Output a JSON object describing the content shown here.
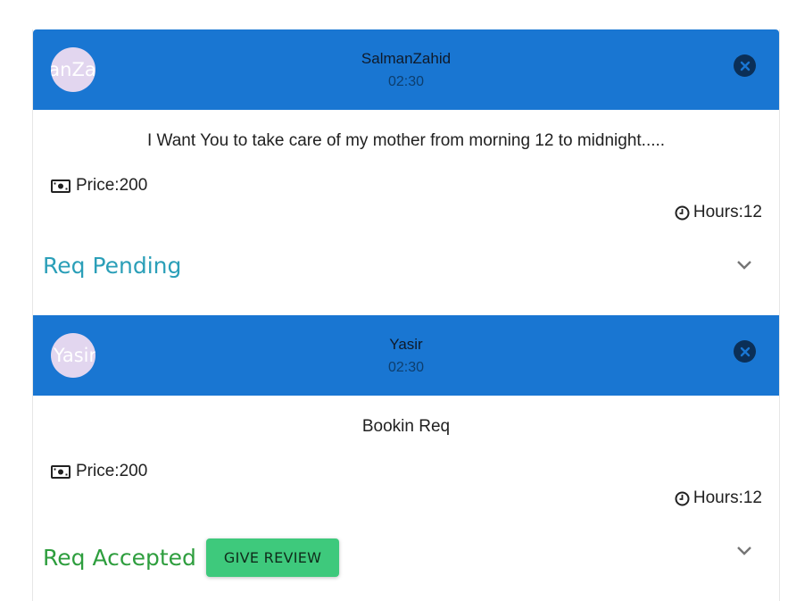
{
  "requests": [
    {
      "avatar_text": "SalmanZahid",
      "name": "SalmanZahid",
      "time": "02:30",
      "message": "I Want You to take care of my mother from morning 12 to midnight.....",
      "price": "Price:200",
      "hours": "Hours:12",
      "status": "Req Pending",
      "review_label": ""
    },
    {
      "avatar_text": "Yasir",
      "name": "Yasir",
      "time": "02:30",
      "message": "Bookin Req",
      "price": "Price:200",
      "hours": "Hours:12",
      "status": "Req Accepted",
      "review_label": "GIVE REVIEW"
    }
  ],
  "icons": {
    "close": "close-circle-icon",
    "money": "money-icon",
    "clock": "clock-icon",
    "expand": "chevron-down-icon"
  },
  "colors": {
    "header": "#1976d2",
    "pending": "#2b9fb8",
    "accepted": "#2e9e3e",
    "review_button": "#3ec97c"
  }
}
